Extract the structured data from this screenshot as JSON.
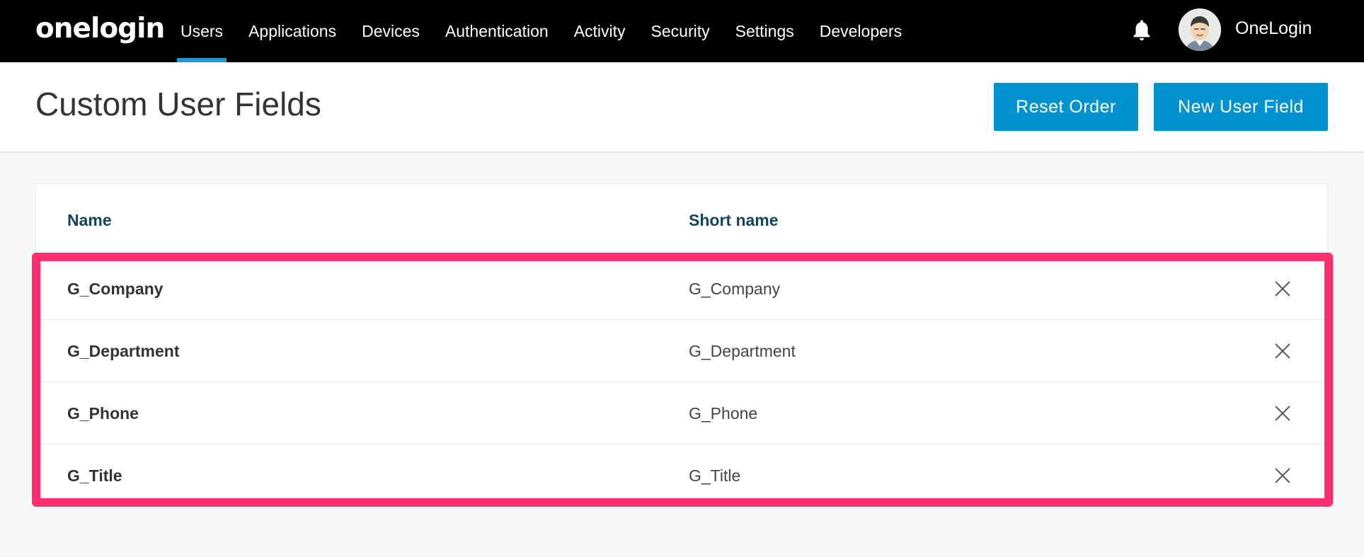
{
  "app": {
    "logo": "onelogin",
    "account_name": "OneLogin"
  },
  "nav": {
    "items": [
      {
        "label": "Users",
        "active": true
      },
      {
        "label": "Applications"
      },
      {
        "label": "Devices"
      },
      {
        "label": "Authentication"
      },
      {
        "label": "Activity"
      },
      {
        "label": "Security"
      },
      {
        "label": "Settings"
      },
      {
        "label": "Developers"
      }
    ],
    "icons": [
      "bell-icon",
      "user-avatar"
    ]
  },
  "header": {
    "title": "Custom User Fields",
    "reset_label": "Reset Order",
    "new_label": "New User Field"
  },
  "table": {
    "columns": [
      "Name",
      "Short name"
    ],
    "rows": [
      {
        "name": "G_Company",
        "short": "G_Company"
      },
      {
        "name": "G_Department",
        "short": "G_Department"
      },
      {
        "name": "G_Phone",
        "short": "G_Phone"
      },
      {
        "name": "G_Title",
        "short": "G_Title"
      }
    ],
    "row_action_icon": "close-icon"
  },
  "colors": {
    "nav_bg": "#000000",
    "accent": "#0093d0",
    "header_text": "#15455e",
    "highlight": "#ff2e6e"
  }
}
